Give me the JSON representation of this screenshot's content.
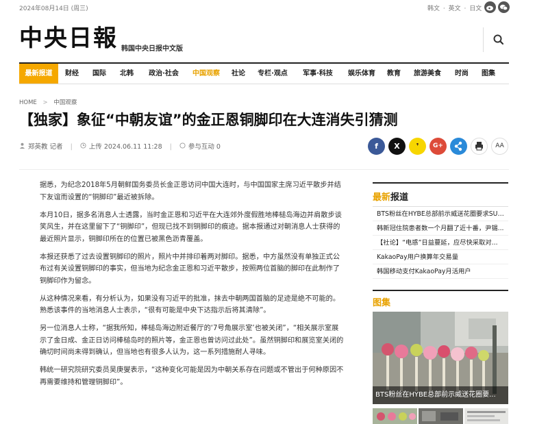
{
  "topbar": {
    "date": "2024年08月14日 (周三)",
    "languages": [
      "韩文",
      "·",
      "英文",
      "·",
      "日文"
    ]
  },
  "masthead": {
    "logo": "中央日報",
    "subtitle": "韩国中央日报中文版"
  },
  "nav": {
    "items": [
      "最新报道",
      "财经",
      "国际",
      "北韩",
      "政治·社会",
      "中国观察",
      "社论",
      "专栏·观点",
      "军事·科技",
      "娱乐体育",
      "教育",
      "旅游美食",
      "时尚",
      "图集"
    ],
    "active": "最新报道",
    "highlight": "中国观察"
  },
  "breadcrumb": {
    "home": "HOME",
    "separator": ">",
    "section": "中国观察"
  },
  "article": {
    "title": "【独家】象征“中朝友谊”的金正恩铜脚印在大连消失引猜测",
    "author": "郑英教 记者",
    "published": "上传 2024.06.11 11:28",
    "comments": "参与互动 0",
    "paragraphs": [
      "据悉，为纪念2018年5月朝鲜国务委员长金正恩访问中国大连时，与中国国家主席习近平散步并结下友谊而设置的“铜脚印”最近被拆除。",
      "本月10日，据多名消息人士透露，当时金正恩和习近平在大连郊外度假胜地棒槌岛海边并肩散步谈笑风生，并在这里留下了“铜脚印”，但现已找不到铜脚印的痕迹。据本报通过对朝消息人士获得的最近照片显示，铜脚印所在的位置已被黑色沥青覆盖。",
      "本报还获悉了过去设置铜脚印的照片，照片中并排印着两对脚印。据悉，中方虽然没有单独正式公布过有关设置铜脚印的事实，但当地为纪念金正恩和习近平散步，按照两位首脑的脚印在此制作了铜脚印作为留念。",
      "从这种情况来看，有分析认为，如果没有习近平的批准，抹去中朝两国首脑的足迹是绝不可能的。熟悉该事件的当地消息人士表示，“很有可能是中央下达指示后将其清除”。",
      "另一位消息人士称，“据我所知，棒槌岛海边附近餐厅的‘7号角展示室’也被关闭”，“相关展示室展示了金日成、金正日访问棒槌岛时的照片等，金正恩也曾访问过此处”。虽然铜脚印和展览室关闭的确切时间尚未得到确认，但当地也有很多人认为，这一系列措施耐人寻味。",
      "韩统一研究院研究委员吴庚燮表示，“这种变化可能是因为中朝关系存在问题或不管出于何种原因不再需要维持和管理铜脚印”。"
    ]
  },
  "share": {
    "facebook": "f",
    "x": "X",
    "kakao": "❜",
    "google": "G+",
    "share": "<",
    "print": "print",
    "font": "AA"
  },
  "sidebar": {
    "latest_head_prefix": "最新",
    "latest_head_suffix": "报道",
    "items": [
      "BTS粉丝在HYBE总部前示威送花圈要求SUG...",
      "韩新冠住院患者数一个月翻了近十番，尹锡...",
      "【社论】“电惑”日益蔓延，应尽快采取对...",
      "KakaoPay用户换算年交易量",
      "韩国移动支付KakaoPay月活用户"
    ],
    "gallery_head": "图集",
    "gallery_caption": "BTS粉丝在HYBE总部前示威送花圈要..."
  },
  "colors": {
    "accent": "#f5a800",
    "facebook": "#3b5998",
    "x": "#111111",
    "kakao": "#f7d600",
    "google": "#dd4b39",
    "share": "#2a8ad9"
  }
}
